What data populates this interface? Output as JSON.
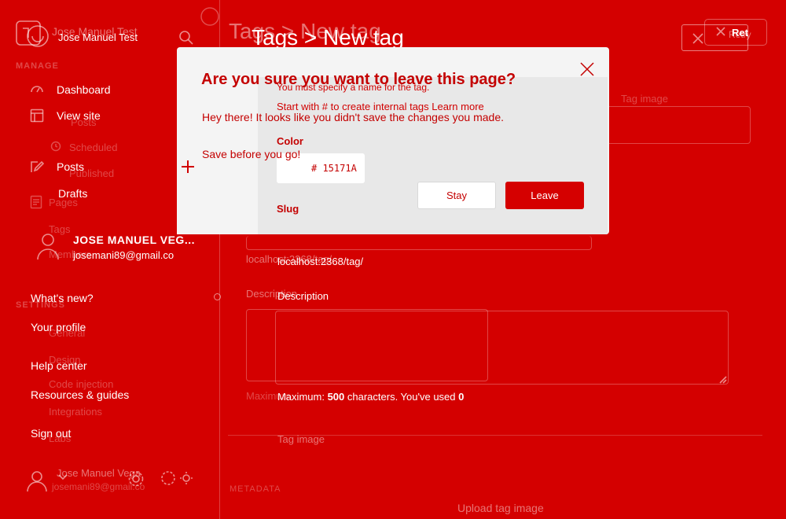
{
  "sidebar": {
    "site_title_ghost": "Jose Manuel Test",
    "site_title": "Jose Manuel Test",
    "manage_heading": "MANAGE",
    "menu": {
      "dashboard": "Dashboard",
      "view_site": "View site",
      "posts": "Posts",
      "drafts": "Drafts",
      "posts_sub": "Posts",
      "scheduled": "Scheduled",
      "published": "Published",
      "pages": "Pages",
      "tags": "Tags",
      "members": "Members"
    },
    "settings_heading": "SETTINGS",
    "settings_items": {
      "general": "General",
      "design": "Design",
      "code_injection": "Code injection",
      "integrations": "Integrations",
      "labs": "Labs"
    },
    "user_menu": {
      "name": "JOSE MANUEL VEG...",
      "email": "josemani89@gmail.co",
      "whats_new": "What's new?",
      "your_profile": "Your profile",
      "help_center": "Help center",
      "resources": "Resources & guides",
      "sign_out": "Sign out"
    },
    "footer_user": {
      "name": "Jose Manuel Vega",
      "email": "josemani89@gmail.co"
    }
  },
  "header": {
    "breadcrumb_ghost": "Tags > New tag",
    "breadcrumb": "Tags > New tag",
    "retry_label": "Ret",
    "retry_ghost": "Retry"
  },
  "form": {
    "name_error": "You must specify a name for the tag.",
    "tag_hint": "Start with # to create internal tags",
    "learn_more": "Learn more",
    "tag_image_label_ghost": "Tag image",
    "color_label": "Color",
    "color_value": "# 15171A",
    "slug_label": "Slug",
    "url_preview": "localhost:2368/tag/",
    "url_preview_ghost": "localhost:2368/tag/",
    "description_label": "Description",
    "description_ghost": "Description",
    "max_hint_prefix": "Maximum: ",
    "max_hint_num": "500",
    "max_hint_suffix": " characters. You've used ",
    "max_hint_used": "0",
    "max_ghost": "Maximum",
    "tag_image_label": "Tag image",
    "upload_label": "Upload tag image",
    "metadata_heading": "METADATA"
  },
  "modal": {
    "title": "Are you sure you want to leave this page?",
    "message1": "Hey there! It looks like you didn't save the changes you made.",
    "message2": "Save before you go!",
    "stay_label": "Stay",
    "leave_label": "Leave"
  },
  "colors": {
    "background": "#d40000",
    "modal_bg": "#f4f4f4",
    "leave_button": "#d50000",
    "title_text": "#c40000"
  }
}
